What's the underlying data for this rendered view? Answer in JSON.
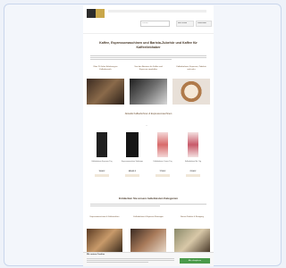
{
  "header": {
    "search_placeholder": "Suchen",
    "account_label": "Mein Konto",
    "cart_label": "Warenkorb"
  },
  "hero": {
    "title": "Kaffee, Espressomaschinen und Barista-Zubehör und Kaffee für Kaffeeliebhaber"
  },
  "features": [
    {
      "title": "Über 20 Jahre Erfahrung im Kaffeebereich"
    },
    {
      "title": "Von den Beratern für Kaffee und Espresso empfohlen"
    },
    {
      "title": "Kaffeebohnen, Espresso, Zubehör und mehr"
    }
  ],
  "products_section": {
    "title": "Aktuelle Kaffeebohnen & Espressomaschinen",
    "dots": "• •"
  },
  "products": [
    {
      "name": "Kaffeebohnen Espresso 1 kg",
      "price": "19,90 €"
    },
    {
      "name": "Espressomaschine Siebträger",
      "price": "899,00 €"
    },
    {
      "name": "Kaffeebohnen Crema 1 kg",
      "price": "17,50 €"
    },
    {
      "name": "Kaffeebohnen Bio 1 kg",
      "price": "21,90 €"
    }
  ],
  "categories_section": {
    "title": "Entdecken Sie unsere beliebtesten Kategorien"
  },
  "categories": [
    {
      "title": "Espressomaschinen & Kaffeemühlen"
    },
    {
      "title": "Kaffeebohnen & Espresso Röstungen"
    },
    {
      "title": "Barista Zubehör & Reinigung"
    }
  ],
  "cookie": {
    "title": "Wir nutzen Cookies",
    "accept_label": "Alle akzeptieren"
  },
  "colors": {
    "brand_brown": "#6a4a2a",
    "accept_green": "#4a9a4a"
  }
}
